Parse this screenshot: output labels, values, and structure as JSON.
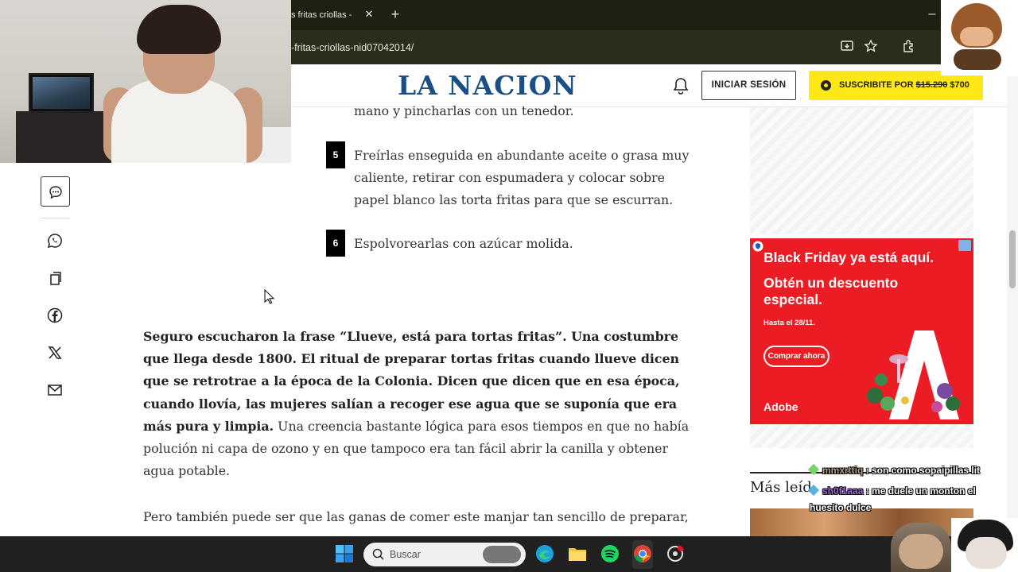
{
  "browser": {
    "tab_title": "s fritas criollas -",
    "tab_close": "✕",
    "new_tab": "+",
    "minimize": "–",
    "url": "-fritas-criollas-nid07042014/"
  },
  "site": {
    "logo": "LA NACION",
    "login_label": "INICIAR SESIÓN",
    "subscribe_label": "SUSCRIBITE POR",
    "price_old": "$15.290",
    "price_new": "$700"
  },
  "article": {
    "step4_tail": "mano y pincharlas con un tenedor.",
    "steps": [
      {
        "num": "5",
        "lines": [
          "Freírlas enseguida en abundante aceite o grasa muy",
          "caliente, retirar con espumadera y colocar sobre",
          "papel blanco las torta fritas para que se escurran."
        ]
      },
      {
        "num": "6",
        "lines": [
          "Espolvorearlas con azúcar molida."
        ]
      }
    ],
    "para1_bold": "Seguro escucharon la frase “Llueve, está para tortas fritas”. Una costumbre que llega desde 1800. El ritual de preparar tortas fritas cuando llueve dicen que se retrotrae a la época de la Colonia. Dicen que dicen que en esa época, cuando llovía, las mujeres salían a recoger ese agua que se suponía que era más pura y limpia.",
    "para1_rest": " Una creencia bastante lógica para esos tiempos en que no había polución ni capa de ozono y en que tampoco era tan fácil abrir la canilla y obtener agua potable.",
    "para2": "Pero también puede ser que las ganas de comer este manjar tan sencillo de preparar,"
  },
  "ad": {
    "title": "Black Friday ya está aquí.",
    "subtitle": "Obtén un descuento especial.",
    "date": "Hasta el 28/11.",
    "cta": "Comprar ahora",
    "brand": "Adobe",
    "color": "#ec1c24"
  },
  "sidebar": {
    "masleidas": "Más leíd"
  },
  "chat": [
    {
      "user": "mmxrttiq",
      "message": " : son como sopaipillas lit"
    },
    {
      "user": "sh0f1aaa",
      "message": " : me duele un monton el"
    },
    {
      "user": "",
      "message": "huesito dulce"
    }
  ],
  "taskbar": {
    "search_placeholder": "Buscar"
  },
  "icons": [
    "comment-icon",
    "whatsapp-icon",
    "copy-icon",
    "facebook-icon",
    "x-icon",
    "mail-icon",
    "bell-icon",
    "windows-start-icon",
    "search-icon",
    "edge-icon",
    "file-explorer-icon",
    "spotify-icon",
    "chrome-icon",
    "settings-icon"
  ]
}
